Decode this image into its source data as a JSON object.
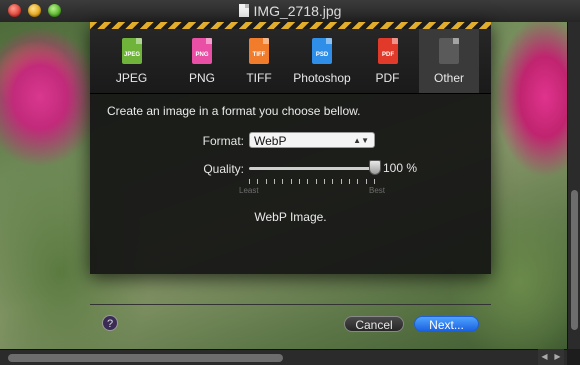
{
  "window": {
    "title": "IMG_2718.jpg"
  },
  "formats": [
    {
      "label": "JPEG",
      "icon_text": "JPEG",
      "color": "#6fb33a"
    },
    {
      "label": "PNG",
      "icon_text": "PNG",
      "color": "#e94fa5"
    },
    {
      "label": "TIFF",
      "icon_text": "TIFF",
      "color": "#f07c2c"
    },
    {
      "label": "Photoshop",
      "icon_text": "PSD",
      "color": "#2f8ee8"
    },
    {
      "label": "PDF",
      "icon_text": "PDF",
      "color": "#e23a2a"
    },
    {
      "label": "Other",
      "icon_text": "",
      "color": "#5a5a5a"
    }
  ],
  "selected_format": "Other",
  "intro": "Create an image in a format you choose bellow.",
  "format_row": {
    "label": "Format:",
    "value": "WebP"
  },
  "quality": {
    "label": "Quality:",
    "value_text": "100 %",
    "value": 1.0,
    "min_label": "Least",
    "max_label": "Best"
  },
  "description": "WebP Image.",
  "buttons": {
    "help": "?",
    "cancel": "Cancel",
    "next": "Next..."
  }
}
